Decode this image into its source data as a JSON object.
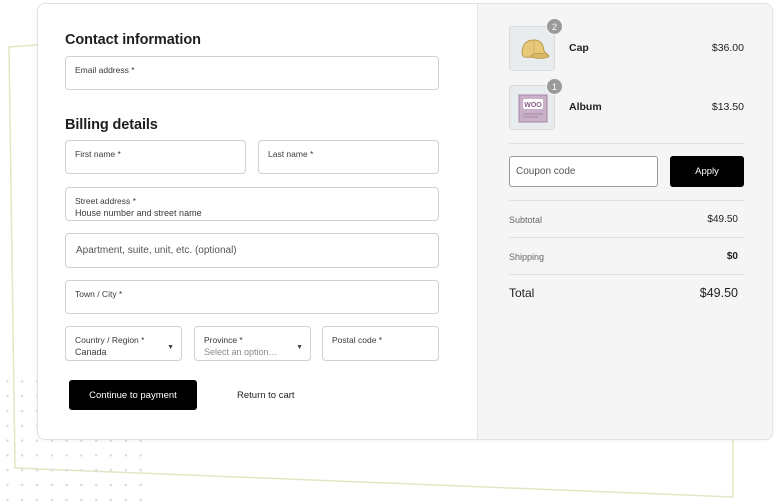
{
  "contact": {
    "heading": "Contact information",
    "email_label": "Email address *"
  },
  "billing": {
    "heading": "Billing details",
    "first_name_label": "First name *",
    "last_name_label": "Last name *",
    "street_label": "Street address *",
    "street_placeholder": "House number and street name",
    "apartment_placeholder": "Apartment, suite, unit, etc. (optional)",
    "city_label": "Town / City *",
    "country_label": "Country / Region *",
    "country_value": "Canada",
    "province_label": "Province *",
    "province_placeholder": "Select an option…",
    "postal_label": "Postal code *"
  },
  "actions": {
    "continue_label": "Continue to payment",
    "return_label": "Return to cart"
  },
  "cart": {
    "items": [
      {
        "name": "Cap",
        "price": "$36.00",
        "quantity": "2",
        "icon": "cap-icon"
      },
      {
        "name": "Album",
        "price": "$13.50",
        "quantity": "1",
        "icon": "woo-album-icon",
        "icon_text": "WOO"
      }
    ],
    "coupon_placeholder": "Coupon code",
    "apply_label": "Apply",
    "subtotal_label": "Subtotal",
    "subtotal_value": "$49.50",
    "shipping_label": "Shipping",
    "shipping_value": "$0",
    "total_label": "Total",
    "total_value": "$49.50"
  },
  "colors": {
    "primary_button": "#000000",
    "deco_line": "#dfe8c4",
    "sidebar_bg": "#f5f5f5"
  }
}
